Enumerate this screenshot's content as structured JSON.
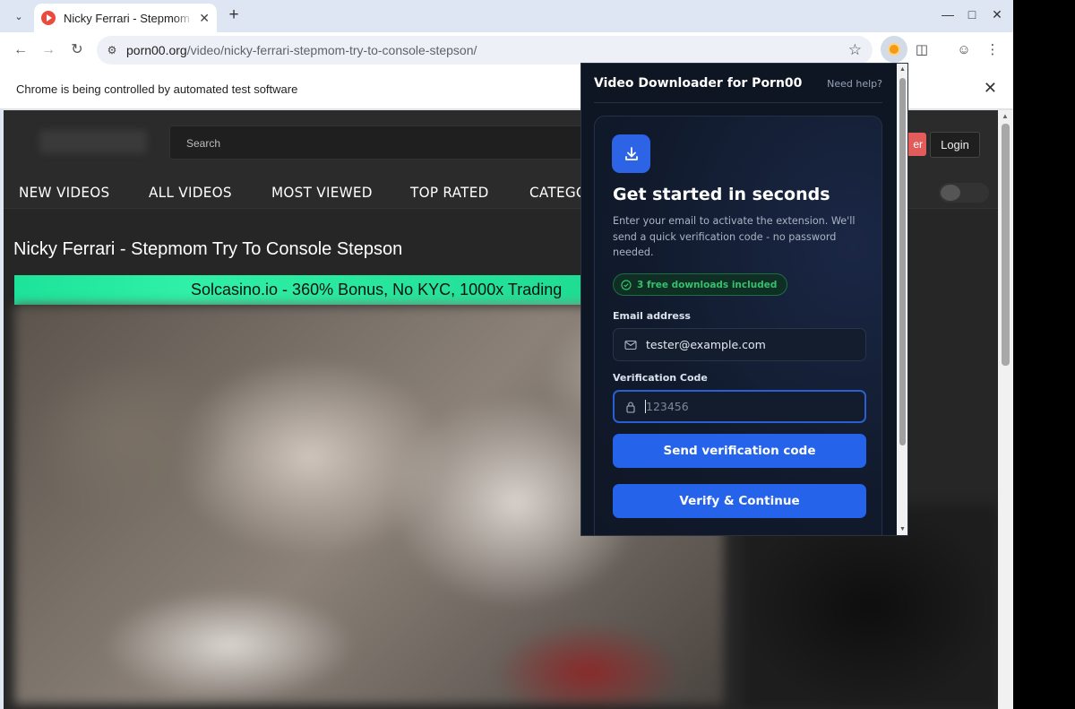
{
  "browser": {
    "tab_title": "Nicky Ferrari - Stepmom Try To Console Stepson",
    "url_host": "porn00.org",
    "url_path": "/video/nicky-ferrari-stepmom-try-to-console-stepson/",
    "infobar_text": "Chrome is being controlled by automated test software"
  },
  "site": {
    "search_placeholder": "Search",
    "register_label": "er",
    "login_label": "Login",
    "nav": [
      "NEW VIDEOS",
      "ALL VIDEOS",
      "MOST VIEWED",
      "TOP RATED",
      "CATEGO"
    ],
    "video_title": "Nicky Ferrari - Stepmom Try To Console Stepson",
    "ad_text": "Solcasino.io - 360% Bonus, No KYC, 1000x Trading"
  },
  "popup": {
    "title": "Video Downloader for Porn00",
    "help": "Need help?",
    "heading": "Get started in seconds",
    "description": "Enter your email to activate the extension. We'll send a quick verification code - no password needed.",
    "badge": "3 free downloads included",
    "email_label": "Email address",
    "email_value": "tester@example.com",
    "code_label": "Verification Code",
    "code_placeholder": "123456",
    "send_button": "Send verification code",
    "verify_button": "Verify & Continue"
  },
  "colors": {
    "accent": "#2563eb",
    "popup_bg": "#0f1623",
    "badge_green": "#34c16d",
    "ad_green": "#1de39a",
    "site_bg": "#262626"
  }
}
